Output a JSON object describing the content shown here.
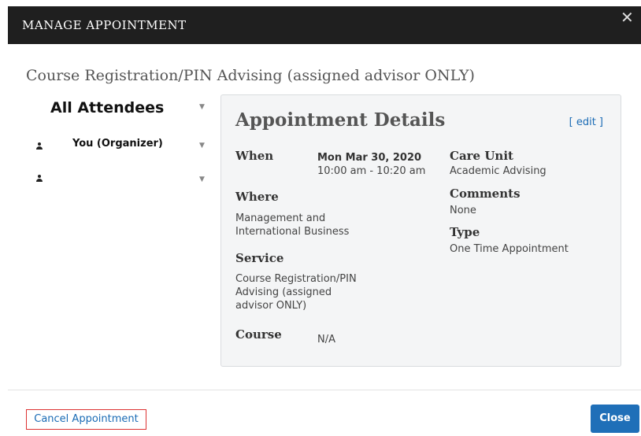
{
  "header": {
    "title": "MANAGE APPOINTMENT",
    "close_glyph": "✕"
  },
  "subtitle": "Course Registration/PIN Advising (assigned advisor ONLY)",
  "attendees": {
    "title": "All Attendees",
    "items": [
      {
        "label": "You (Organizer)",
        "icon": "person-icon"
      },
      {
        "label": "",
        "icon": "person-icon"
      }
    ]
  },
  "details": {
    "title": "Appointment Details",
    "edit_label": "[ edit ]",
    "when_label": "When",
    "when_date": "Mon Mar 30, 2020",
    "when_time": "10:00 am - 10:20 am",
    "where_label": "Where",
    "where_value": "Management and International Business",
    "service_label": "Service",
    "service_value": "Course Registration/PIN Advising (assigned advisor ONLY)",
    "course_label": "Course",
    "course_value": "N/A",
    "care_unit_label": "Care Unit",
    "care_unit_value": "Academic Advising",
    "comments_label": "Comments",
    "comments_value": "None",
    "type_label": "Type",
    "type_value": "One Time Appointment"
  },
  "footer": {
    "cancel_label": "Cancel Appointment",
    "close_label": "Close"
  },
  "colors": {
    "header_bg": "#1f1f1f",
    "link": "#1a6bb5",
    "primary_button": "#1f6fb8",
    "highlight_border": "#dd3333",
    "card_bg": "#f4f5f6"
  }
}
